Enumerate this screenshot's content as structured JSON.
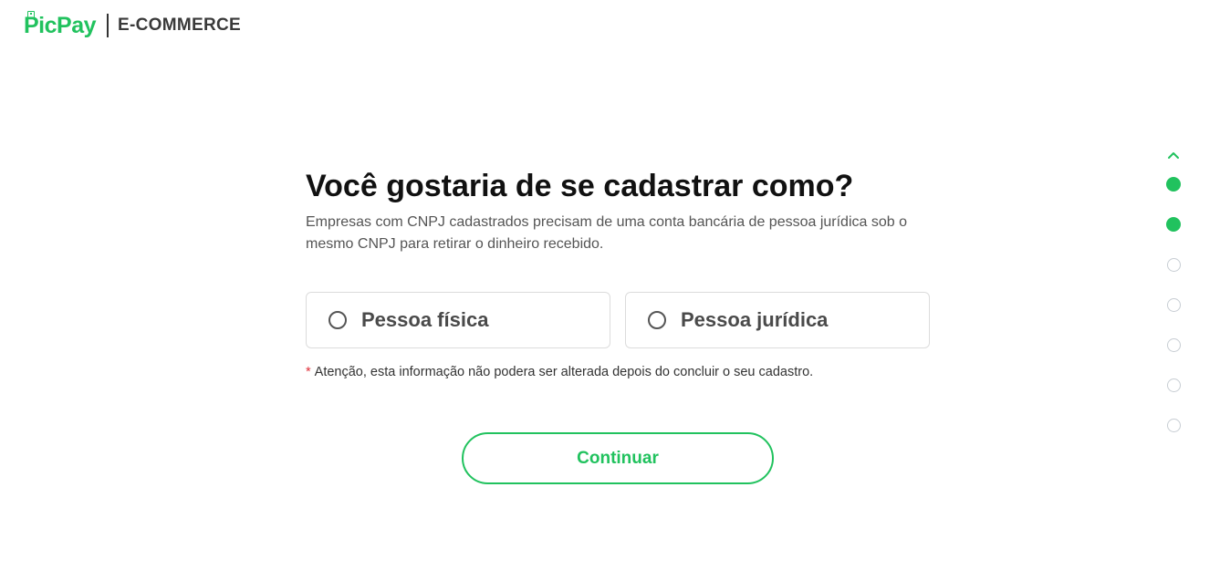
{
  "header": {
    "logo_text": "PicPay",
    "brand_subtitle": "E-COMMERCE"
  },
  "main": {
    "title": "Você gostaria de se cadastrar como?",
    "subtitle": "Empresas com CNPJ cadastrados precisam de uma conta bancária de pessoa jurídica sob o mesmo CNPJ para retirar o dinheiro recebido.",
    "options": [
      {
        "label": "Pessoa física",
        "selected": false
      },
      {
        "label": "Pessoa jurídica",
        "selected": false
      }
    ],
    "notice_marker": "*",
    "notice_text": "Atenção, esta informação não podera ser alterada depois do concluir o seu cadastro.",
    "continue_label": "Continuar"
  },
  "stepper": {
    "icon": "chevron-up-icon",
    "steps_completed": 2,
    "steps_total": 7
  },
  "colors": {
    "accent": "#21c25e",
    "text_dark": "#111111",
    "text_muted": "#555555",
    "border": "#dcdcdc",
    "required": "#e0303a",
    "step_inactive": "#c7cdd3"
  }
}
